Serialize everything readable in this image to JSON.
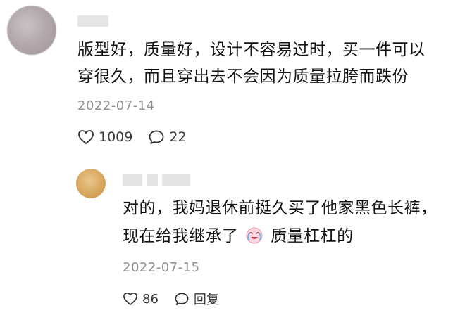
{
  "comment": {
    "text_line1": "版型好，质量好，设计不容易过时，买一件可以",
    "text_line2": "穿很久，而且穿出去不会因为质量拉胯而跌份",
    "date": "2022-07-14",
    "likes": "1009",
    "replies": "22",
    "icons": {
      "like": "heart-icon",
      "comment": "comment-icon"
    }
  },
  "reply": {
    "text_line1": "对的，我妈退休前挺久买了他家黑色长裤，",
    "text_line2_a": "现在给我继承了",
    "text_line2_b": "质量杠杠的",
    "emoji": "crying-laughing-emoji",
    "date": "2022-07-15",
    "likes": "86",
    "reply_label": "回复",
    "icons": {
      "like": "heart-icon",
      "reply": "comment-icon"
    }
  }
}
